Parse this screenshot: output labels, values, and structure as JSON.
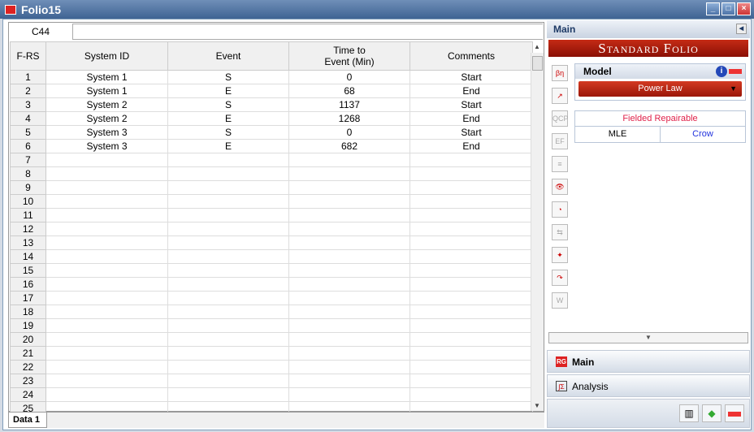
{
  "window": {
    "title": "Folio15",
    "app_icon": "RG"
  },
  "cell_ref": "C44",
  "formula": "",
  "columns": [
    "F-RS",
    "System ID",
    "Event",
    "Time to\nEvent (Min)",
    "Comments"
  ],
  "rows": [
    [
      "1",
      "System 1",
      "S",
      "0",
      "Start"
    ],
    [
      "2",
      "System 1",
      "E",
      "68",
      "End"
    ],
    [
      "3",
      "System 2",
      "S",
      "1137",
      "Start"
    ],
    [
      "4",
      "System 2",
      "E",
      "1268",
      "End"
    ],
    [
      "5",
      "System 3",
      "S",
      "0",
      "Start"
    ],
    [
      "6",
      "System 3",
      "E",
      "682",
      "End"
    ],
    [
      "7",
      "",
      "",
      "",
      ""
    ],
    [
      "8",
      "",
      "",
      "",
      ""
    ],
    [
      "9",
      "",
      "",
      "",
      ""
    ],
    [
      "10",
      "",
      "",
      "",
      ""
    ],
    [
      "11",
      "",
      "",
      "",
      ""
    ],
    [
      "12",
      "",
      "",
      "",
      ""
    ],
    [
      "13",
      "",
      "",
      "",
      ""
    ],
    [
      "14",
      "",
      "",
      "",
      ""
    ],
    [
      "15",
      "",
      "",
      "",
      ""
    ],
    [
      "16",
      "",
      "",
      "",
      ""
    ],
    [
      "17",
      "",
      "",
      "",
      ""
    ],
    [
      "18",
      "",
      "",
      "",
      ""
    ],
    [
      "19",
      "",
      "",
      "",
      ""
    ],
    [
      "20",
      "",
      "",
      "",
      ""
    ],
    [
      "21",
      "",
      "",
      "",
      ""
    ],
    [
      "22",
      "",
      "",
      "",
      ""
    ],
    [
      "23",
      "",
      "",
      "",
      ""
    ],
    [
      "24",
      "",
      "",
      "",
      ""
    ],
    [
      "25",
      "",
      "",
      "",
      ""
    ]
  ],
  "sheet_tab": "Data 1",
  "side": {
    "header": "Main",
    "banner": "Standard Folio",
    "model_label": "Model",
    "model_value": "Power Law",
    "data_type": "Fielded Repairable",
    "method": "MLE",
    "variant": "Crow",
    "nav": [
      "Main",
      "Analysis"
    ],
    "tools": [
      "parameters-icon",
      "plot-icon",
      "qcp-icon",
      "ef-icon",
      "batch-icon",
      "view-icon",
      "gauge-icon",
      "transfer-icon",
      "wizard-icon",
      "redo-icon",
      "analysis-icon"
    ],
    "accent": "#b5200e"
  }
}
